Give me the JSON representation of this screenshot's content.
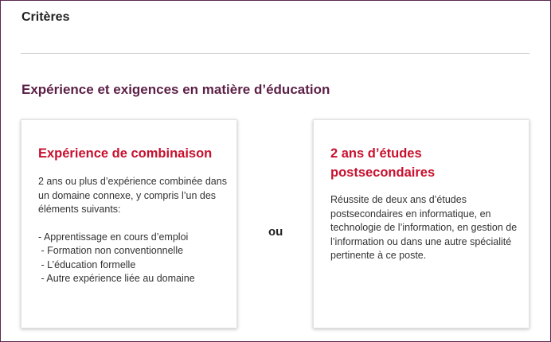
{
  "page": {
    "heading": "Critères",
    "section_title": "Expérience et exigences en matière d’éducation"
  },
  "options": [
    {
      "title": "Expérience de combinaison",
      "intro": "2 ans ou plus d’expérience combinée dans un domaine connexe, y compris l’un des éléments suivants:",
      "items": [
        "- Apprentissage en cours d’emploi",
        " - Formation non conventionnelle",
        " - L’éducation formelle",
        " - Autre expérience liée au domaine"
      ]
    },
    {
      "title": "2 ans d’études postsecondaires",
      "intro": "Réussite de deux ans d’études postsecondaires en informatique, en technologie de l’information, en gestion de l’information ou dans une autre spécialité pertinente à ce poste."
    }
  ],
  "connector": "ou",
  "colors": {
    "section_title": "#5b1f45",
    "card_title": "#c8102e",
    "frame_border": "#5a2a4e"
  }
}
